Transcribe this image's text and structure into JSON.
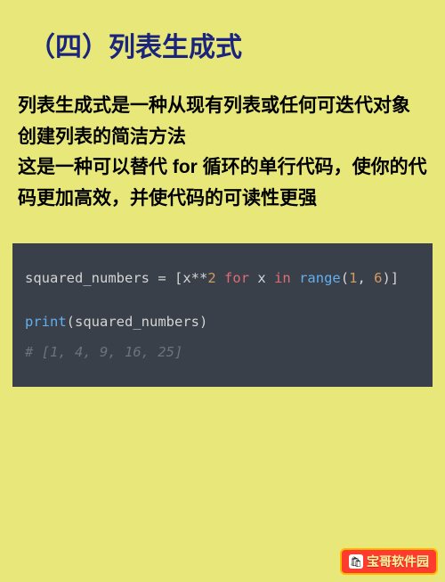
{
  "heading": "（四）列表生成式",
  "body": {
    "p1": "列表生成式是一种从现有列表或任何可迭代对象创建列表的简洁方法",
    "p2": "这是一种可以替代 for 循环的单行代码，使你的代码更加高效，并使代码的可读性更强"
  },
  "code": {
    "line1": {
      "var": "squared_numbers",
      "eq": " = ",
      "lb": "[",
      "expr1": "x",
      "op1": "**",
      "n2": "2",
      "sp1": " ",
      "kw_for": "for",
      "sp2": " ",
      "expr2": "x",
      "sp3": " ",
      "kw_in": "in",
      "sp4": " ",
      "fn": "range",
      "lp": "(",
      "a1": "1",
      "comma": ", ",
      "a2": "6",
      "rp": ")",
      "rb": "]"
    },
    "line2": {
      "fn": "print",
      "lp": "(",
      "arg": "squared_numbers",
      "rp": ")"
    },
    "line3": "# [1, 4, 9, 16, 25]"
  },
  "watermark": {
    "icon": "🛍",
    "text": "宝哥软件园"
  }
}
